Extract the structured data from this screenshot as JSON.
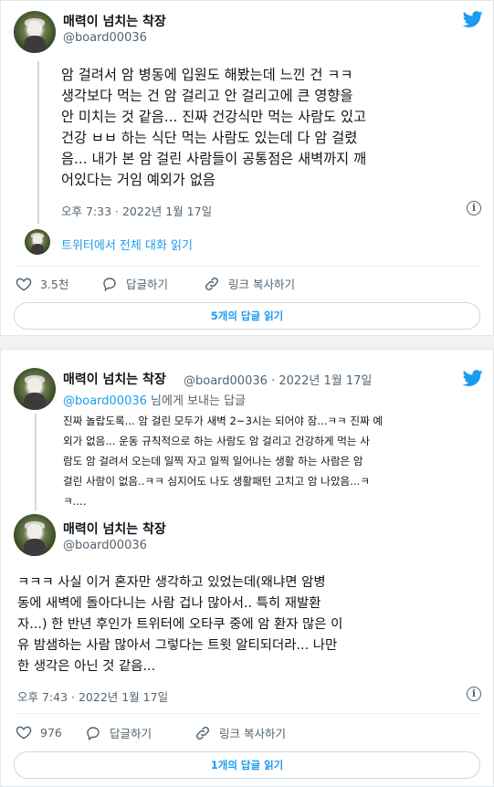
{
  "tweet1": {
    "author_name": "매력이 넘치는 착장",
    "author_handle": "@board00036",
    "text_lines": [
      "암 걸려서 암 병동에 입원도 해봤는데 느낀 건 ㅋㅋ",
      "생각보다 먹는 건 암 걸리고 안 걸리고에 큰 영향을",
      "안 미치는 것 같음... 진짜 건강식만 먹는 사람도 있고",
      "건강 ㅂㅂ 하는 식단 먹는 사람도 있는데 다 암 걸렸",
      "음... 내가 본 암 걸린 사람들이 공통점은 새벽까지 깨",
      "어있다는 거임 예외가 없음"
    ],
    "timestamp": "오후 7:33 · 2022년 1월 17일",
    "conversation_link": "트위터에서 전체 대화 읽기",
    "likes": "3.5천",
    "reply_label": "답글하기",
    "copy_link_label": "링크 복사하기",
    "replies_button": "5개의 답글 읽기"
  },
  "tweet2": {
    "reply": {
      "author_name": "매력이 넘치는 착장",
      "author_handle": "@board00036 · 2022년 1월 17일",
      "reply_to_handle": "@board00036",
      "reply_to_suffix": " 님에게 보내는 답글",
      "text_lines": [
        "진짜 놀랍도록... 암 걸린 모두가 새벽 2~3시는 되어야 잠...ㅋㅋ 진짜 예",
        "외가 없음... 운동 규칙적으로 하는 사람도 암 걸리고 건강하게 먹는 사",
        "람도 암 걸려서 오는데 일찍 자고 일찍 일어나는 생활 하는 사람은 암",
        "걸린 사람이 없음..ㅋㅋ 심지어도 나도 생활패턴 고치고 암 나았음...ㅋ",
        "ㅋ...."
      ]
    },
    "main": {
      "author_name": "매력이 넘치는 착장",
      "author_handle": "@board00036",
      "text_lines": [
        "ㅋㅋㅋ 사실 이거 혼자만 생각하고 있었는데(왜냐면 암병",
        "동에 새벽에 돌아다니는 사람 겁나 많아서.. 특히 재발환",
        "자...) 한 반년 후인가 트위터에 오타쿠 중에 암 환자 많은 이",
        "유 밤샘하는 사람 많아서 그렇다는 트윗 알티되더라... 나만",
        "한 생각은 아닌 것 같음..."
      ],
      "timestamp": "오후 7:43 · 2022년 1월 17일",
      "likes": "976",
      "reply_label": "답글하기",
      "copy_link_label": "링크 복사하기",
      "replies_button": "1개의 답글 읽기"
    }
  },
  "colors": {
    "brand_blue": "#1d9bf0",
    "secondary_text": "#536471",
    "divider": "#eff3f4"
  },
  "icons": [
    "avatar",
    "twitter-bird-icon",
    "info-icon",
    "heart-icon",
    "reply-icon",
    "link-icon"
  ]
}
